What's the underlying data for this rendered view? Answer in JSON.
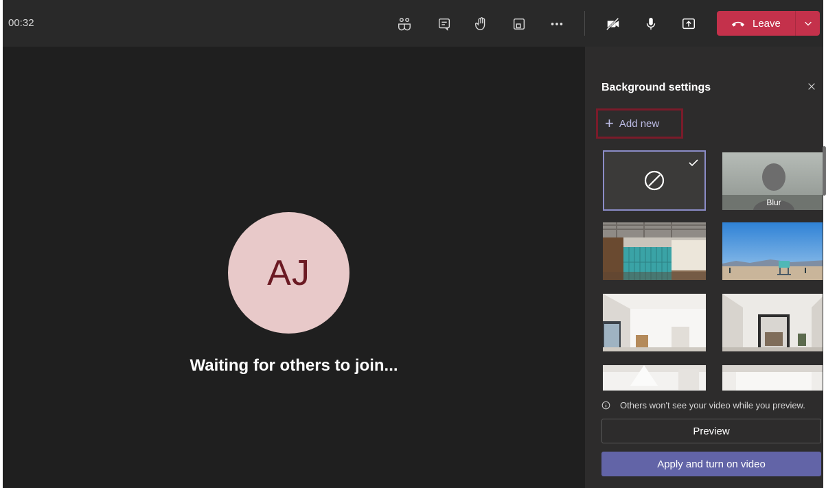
{
  "meeting": {
    "timer": "00:32",
    "waiting_text": "Waiting for others to join...",
    "avatar_initials": "AJ"
  },
  "toolbar": {
    "icons": [
      "people-icon",
      "chat-icon",
      "raise-hand-icon",
      "rooms-icon",
      "more-icon",
      "camera-off-icon",
      "mic-icon",
      "share-icon"
    ],
    "leave_label": "Leave"
  },
  "background_panel": {
    "title": "Background settings",
    "add_new_label": "Add new",
    "options": [
      {
        "name": "none",
        "selected": true
      },
      {
        "name": "Blur",
        "label": "Blur",
        "selected": false
      },
      {
        "name": "office-lockers",
        "selected": false
      },
      {
        "name": "beach-lifeguard",
        "selected": false
      },
      {
        "name": "white-room-1",
        "selected": false
      },
      {
        "name": "white-room-2",
        "selected": false
      },
      {
        "name": "white-room-3",
        "selected": false
      },
      {
        "name": "white-room-4",
        "selected": false
      }
    ],
    "info_text": "Others won't see your video while you preview.",
    "preview_label": "Preview",
    "apply_label": "Apply and turn on video"
  },
  "colors": {
    "leave": "#c4314b",
    "accent": "#6264a7",
    "selected_border": "#8b8cc7",
    "highlight_box": "#7a1b2a",
    "avatar_bg": "#e8c9c9",
    "avatar_text": "#6b1a23"
  }
}
